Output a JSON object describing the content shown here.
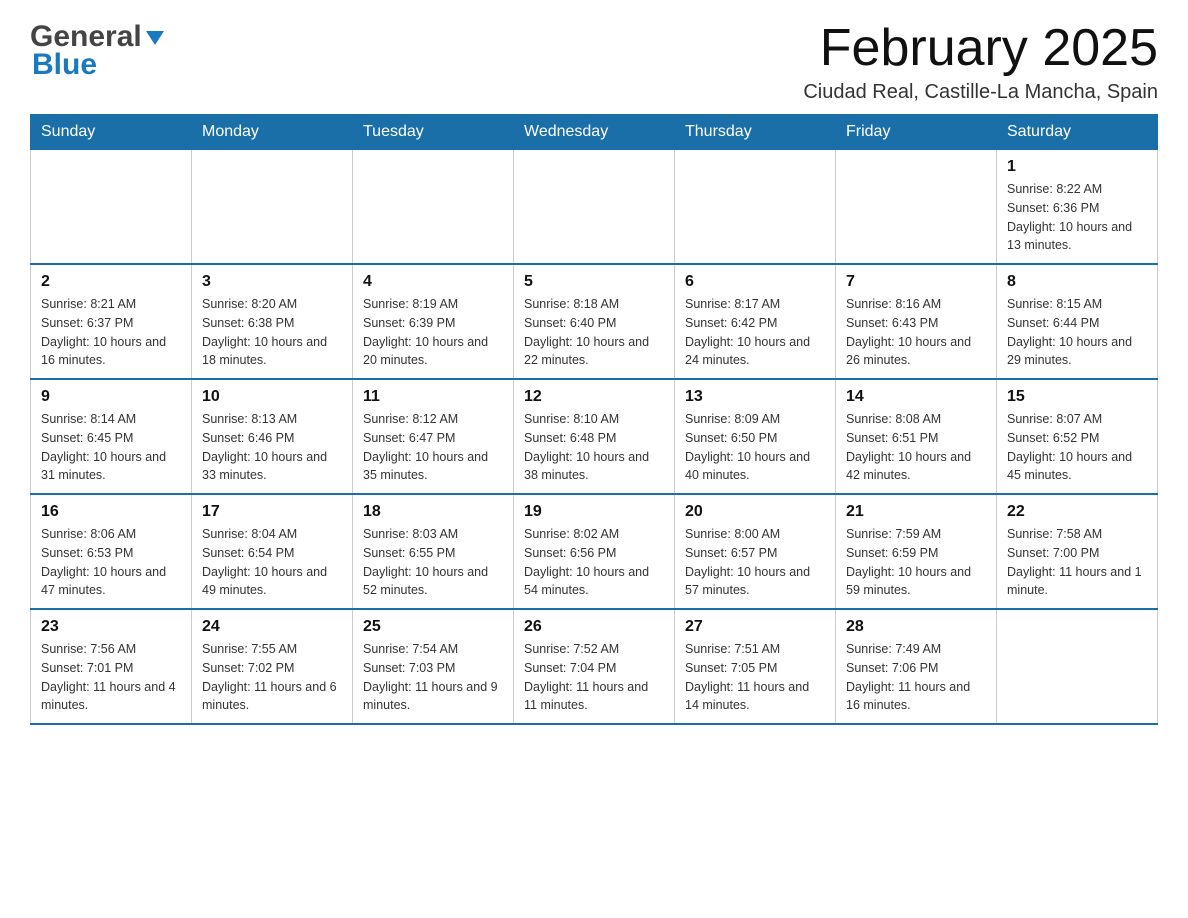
{
  "header": {
    "logo_general": "General",
    "logo_blue": "Blue",
    "month_title": "February 2025",
    "location": "Ciudad Real, Castille-La Mancha, Spain"
  },
  "days_of_week": [
    "Sunday",
    "Monday",
    "Tuesday",
    "Wednesday",
    "Thursday",
    "Friday",
    "Saturday"
  ],
  "weeks": [
    [
      {
        "day": "",
        "info": ""
      },
      {
        "day": "",
        "info": ""
      },
      {
        "day": "",
        "info": ""
      },
      {
        "day": "",
        "info": ""
      },
      {
        "day": "",
        "info": ""
      },
      {
        "day": "",
        "info": ""
      },
      {
        "day": "1",
        "info": "Sunrise: 8:22 AM\nSunset: 6:36 PM\nDaylight: 10 hours and 13 minutes."
      }
    ],
    [
      {
        "day": "2",
        "info": "Sunrise: 8:21 AM\nSunset: 6:37 PM\nDaylight: 10 hours and 16 minutes."
      },
      {
        "day": "3",
        "info": "Sunrise: 8:20 AM\nSunset: 6:38 PM\nDaylight: 10 hours and 18 minutes."
      },
      {
        "day": "4",
        "info": "Sunrise: 8:19 AM\nSunset: 6:39 PM\nDaylight: 10 hours and 20 minutes."
      },
      {
        "day": "5",
        "info": "Sunrise: 8:18 AM\nSunset: 6:40 PM\nDaylight: 10 hours and 22 minutes."
      },
      {
        "day": "6",
        "info": "Sunrise: 8:17 AM\nSunset: 6:42 PM\nDaylight: 10 hours and 24 minutes."
      },
      {
        "day": "7",
        "info": "Sunrise: 8:16 AM\nSunset: 6:43 PM\nDaylight: 10 hours and 26 minutes."
      },
      {
        "day": "8",
        "info": "Sunrise: 8:15 AM\nSunset: 6:44 PM\nDaylight: 10 hours and 29 minutes."
      }
    ],
    [
      {
        "day": "9",
        "info": "Sunrise: 8:14 AM\nSunset: 6:45 PM\nDaylight: 10 hours and 31 minutes."
      },
      {
        "day": "10",
        "info": "Sunrise: 8:13 AM\nSunset: 6:46 PM\nDaylight: 10 hours and 33 minutes."
      },
      {
        "day": "11",
        "info": "Sunrise: 8:12 AM\nSunset: 6:47 PM\nDaylight: 10 hours and 35 minutes."
      },
      {
        "day": "12",
        "info": "Sunrise: 8:10 AM\nSunset: 6:48 PM\nDaylight: 10 hours and 38 minutes."
      },
      {
        "day": "13",
        "info": "Sunrise: 8:09 AM\nSunset: 6:50 PM\nDaylight: 10 hours and 40 minutes."
      },
      {
        "day": "14",
        "info": "Sunrise: 8:08 AM\nSunset: 6:51 PM\nDaylight: 10 hours and 42 minutes."
      },
      {
        "day": "15",
        "info": "Sunrise: 8:07 AM\nSunset: 6:52 PM\nDaylight: 10 hours and 45 minutes."
      }
    ],
    [
      {
        "day": "16",
        "info": "Sunrise: 8:06 AM\nSunset: 6:53 PM\nDaylight: 10 hours and 47 minutes."
      },
      {
        "day": "17",
        "info": "Sunrise: 8:04 AM\nSunset: 6:54 PM\nDaylight: 10 hours and 49 minutes."
      },
      {
        "day": "18",
        "info": "Sunrise: 8:03 AM\nSunset: 6:55 PM\nDaylight: 10 hours and 52 minutes."
      },
      {
        "day": "19",
        "info": "Sunrise: 8:02 AM\nSunset: 6:56 PM\nDaylight: 10 hours and 54 minutes."
      },
      {
        "day": "20",
        "info": "Sunrise: 8:00 AM\nSunset: 6:57 PM\nDaylight: 10 hours and 57 minutes."
      },
      {
        "day": "21",
        "info": "Sunrise: 7:59 AM\nSunset: 6:59 PM\nDaylight: 10 hours and 59 minutes."
      },
      {
        "day": "22",
        "info": "Sunrise: 7:58 AM\nSunset: 7:00 PM\nDaylight: 11 hours and 1 minute."
      }
    ],
    [
      {
        "day": "23",
        "info": "Sunrise: 7:56 AM\nSunset: 7:01 PM\nDaylight: 11 hours and 4 minutes."
      },
      {
        "day": "24",
        "info": "Sunrise: 7:55 AM\nSunset: 7:02 PM\nDaylight: 11 hours and 6 minutes."
      },
      {
        "day": "25",
        "info": "Sunrise: 7:54 AM\nSunset: 7:03 PM\nDaylight: 11 hours and 9 minutes."
      },
      {
        "day": "26",
        "info": "Sunrise: 7:52 AM\nSunset: 7:04 PM\nDaylight: 11 hours and 11 minutes."
      },
      {
        "day": "27",
        "info": "Sunrise: 7:51 AM\nSunset: 7:05 PM\nDaylight: 11 hours and 14 minutes."
      },
      {
        "day": "28",
        "info": "Sunrise: 7:49 AM\nSunset: 7:06 PM\nDaylight: 11 hours and 16 minutes."
      },
      {
        "day": "",
        "info": ""
      }
    ]
  ]
}
